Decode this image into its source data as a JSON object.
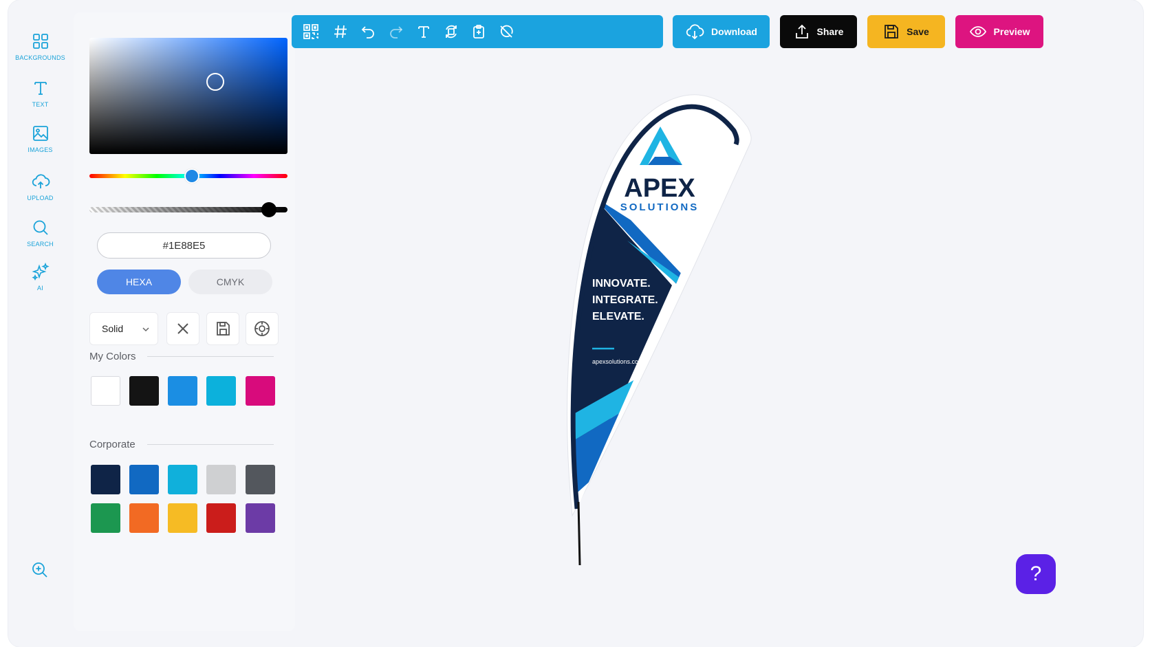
{
  "sidebar": {
    "items": [
      {
        "label": "BACKGROUNDS",
        "icon": "grid-icon"
      },
      {
        "label": "TEXT",
        "icon": "text-icon"
      },
      {
        "label": "IMAGES",
        "icon": "image-icon"
      },
      {
        "label": "UPLOAD",
        "icon": "cloud-upload-icon"
      },
      {
        "label": "SEARCH",
        "icon": "search-icon"
      },
      {
        "label": "AI",
        "icon": "sparkles-icon"
      }
    ],
    "zoom_icon": "zoom-in-icon"
  },
  "color_picker": {
    "hex_value": "#1E88E5",
    "hue_color": "#0064ff",
    "selected_color": "#1E88E5",
    "modes": {
      "hexa": "HEXA",
      "cmyk": "CMYK",
      "active": "HEXA"
    },
    "fill_type": "Solid",
    "tool_icons": [
      "close-icon",
      "save-icon",
      "eyedropper-icon"
    ]
  },
  "my_colors": {
    "title": "My Colors",
    "swatches": [
      "#ffffff",
      "#141414",
      "#1b8ee3",
      "#0cb1dc",
      "#d80b7c"
    ]
  },
  "corporate": {
    "title": "Corporate",
    "swatches": [
      "#0f2447",
      "#1169c2",
      "#10b0db",
      "#cfd0d2",
      "#53575d",
      "#1c9750",
      "#f26a23",
      "#f6bb24",
      "#cb1d1b",
      "#6c3ba6"
    ]
  },
  "toolbar": {
    "icons": [
      "qr-code-icon",
      "grid-hash-icon",
      "undo-icon",
      "redo-icon",
      "text-tool-icon",
      "rotate-icon",
      "clipboard-icon",
      "hide-icon"
    ],
    "download_label": "Download",
    "share_label": "Share",
    "save_label": "Save",
    "preview_label": "Preview"
  },
  "flag": {
    "brand": "APEX",
    "subbrand": "SOLUTIONS",
    "tagline": [
      "INNOVATE.",
      "INTEGRATE.",
      "ELEVATE."
    ],
    "website": "apexsolutions.com",
    "colors": {
      "navy": "#0f2447",
      "blue": "#1169c2",
      "cyan": "#1fb4e3"
    }
  },
  "help": {
    "label": "?"
  }
}
